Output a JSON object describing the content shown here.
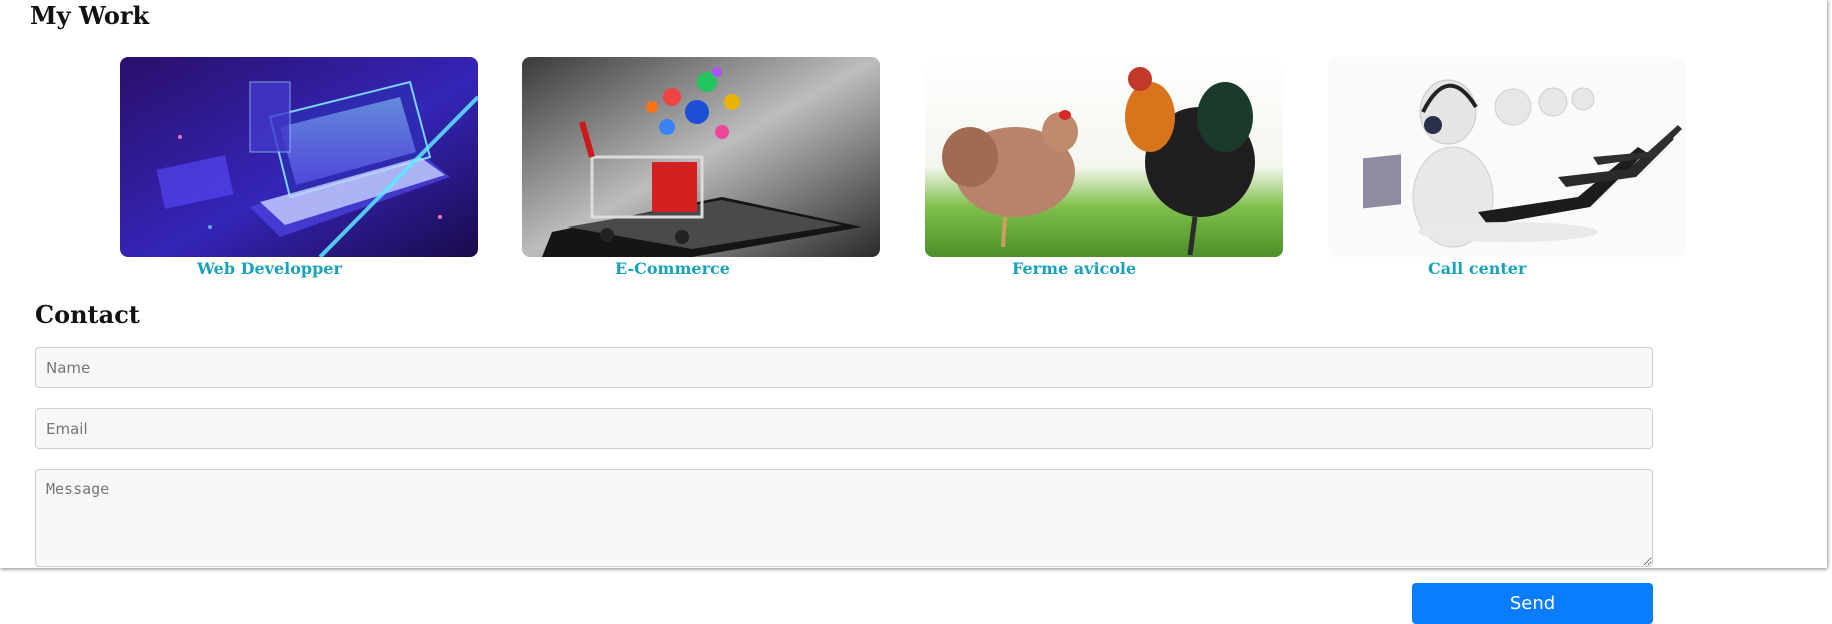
{
  "work": {
    "title": "My Work",
    "items": [
      {
        "label": "Web Developper",
        "image": "laptop-code-illustration"
      },
      {
        "label": "E-Commerce",
        "image": "shopping-cart-on-tablet"
      },
      {
        "label": "Ferme avicole",
        "image": "hen-and-rooster-on-grass"
      },
      {
        "label": "Call center",
        "image": "3d-operators-with-headsets"
      }
    ]
  },
  "contact": {
    "title": "Contact",
    "name_placeholder": "Name",
    "email_placeholder": "Email",
    "message_placeholder": "Message",
    "send_label": "Send"
  },
  "colors": {
    "caption": "#17a2b8",
    "button": "#0a7cff"
  }
}
